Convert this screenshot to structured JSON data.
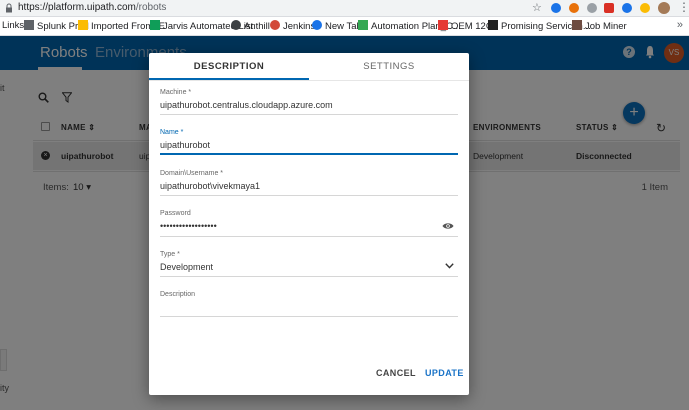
{
  "browser": {
    "url_host": "https://platform.uipath.com",
    "url_path": "/robots"
  },
  "bookmarks": [
    "Links",
    "Splunk Prod",
    "Imported From IE",
    "Jarvis Automated List",
    "Anthill",
    "Jenkins",
    "New Tab",
    "Automation Plan_C...",
    "OEM 12C",
    "Promising Servicen...",
    "Job Miner"
  ],
  "app": {
    "tabs": [
      "Robots",
      "Environments"
    ],
    "help_glyph": "?",
    "user_initials": "VS",
    "accent": "#0167b1",
    "avatar_color": "#e05c26"
  },
  "table": {
    "columns": [
      "NAME",
      "MA",
      "ENVIRONMENTS",
      "STATUS"
    ],
    "rows": [
      {
        "name": "uipathurobot",
        "machine": "uip",
        "environment": "Development",
        "status": "Disconnected"
      }
    ],
    "items_label": "Items:",
    "items_per_page": "10",
    "total": "1 Item"
  },
  "left_nav_fragments": [
    "it",
    "ity"
  ],
  "modal": {
    "tabs": [
      "DESCRIPTION",
      "SETTINGS"
    ],
    "fields": {
      "machine": {
        "label": "Machine *",
        "value": "uipathurobot.centralus.cloudapp.azure.com"
      },
      "name": {
        "label": "Name *",
        "value": "uipathurobot"
      },
      "domain": {
        "label": "Domain\\Username *",
        "value": "uipathurobot\\vivekmaya1"
      },
      "password": {
        "label": "Password",
        "value": "••••••••••••••••••"
      },
      "type": {
        "label": "Type *",
        "value": "Development"
      },
      "description": {
        "label": "Description",
        "value": ""
      }
    },
    "buttons": {
      "cancel": "CANCEL",
      "update": "UPDATE"
    }
  }
}
